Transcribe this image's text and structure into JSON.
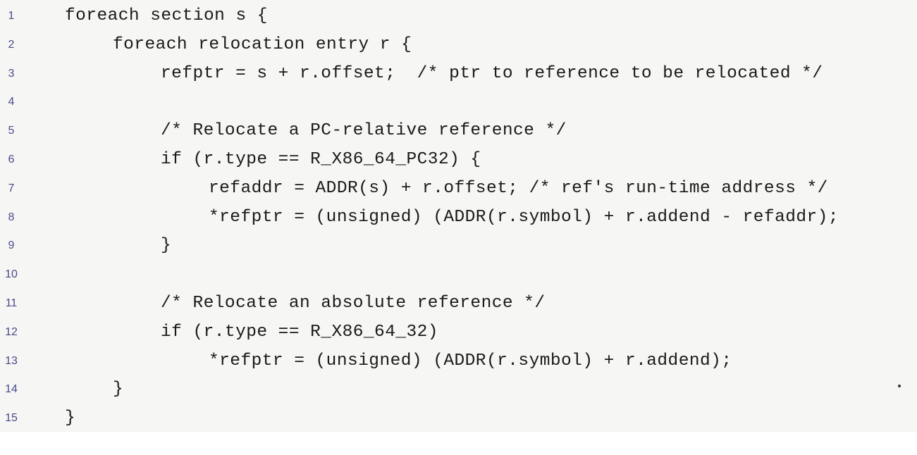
{
  "listing": {
    "lines": [
      {
        "number": "1",
        "code": "foreach section s {"
      },
      {
        "number": "2",
        "code": "foreach relocation entry r {"
      },
      {
        "number": "3",
        "code": "refptr = s + r.offset;  /* ptr to reference to be relocated */"
      },
      {
        "number": "4",
        "code": ""
      },
      {
        "number": "5",
        "code": "/* Relocate a PC-relative reference */"
      },
      {
        "number": "6",
        "code": "if (r.type == R_X86_64_PC32) {"
      },
      {
        "number": "7",
        "code": "refaddr = ADDR(s) + r.offset; /* ref's run-time address */"
      },
      {
        "number": "8",
        "code": "*refptr = (unsigned) (ADDR(r.symbol) + r.addend - refaddr);"
      },
      {
        "number": "9",
        "code": "}"
      },
      {
        "number": "10",
        "code": ""
      },
      {
        "number": "11",
        "code": "/* Relocate an absolute reference */"
      },
      {
        "number": "12",
        "code": "if (r.type == R_X86_64_32)"
      },
      {
        "number": "13",
        "code": "*refptr = (unsigned) (ADDR(r.symbol) + r.addend);"
      },
      {
        "number": "14",
        "code": "}"
      },
      {
        "number": "15",
        "code": "}"
      }
    ]
  }
}
